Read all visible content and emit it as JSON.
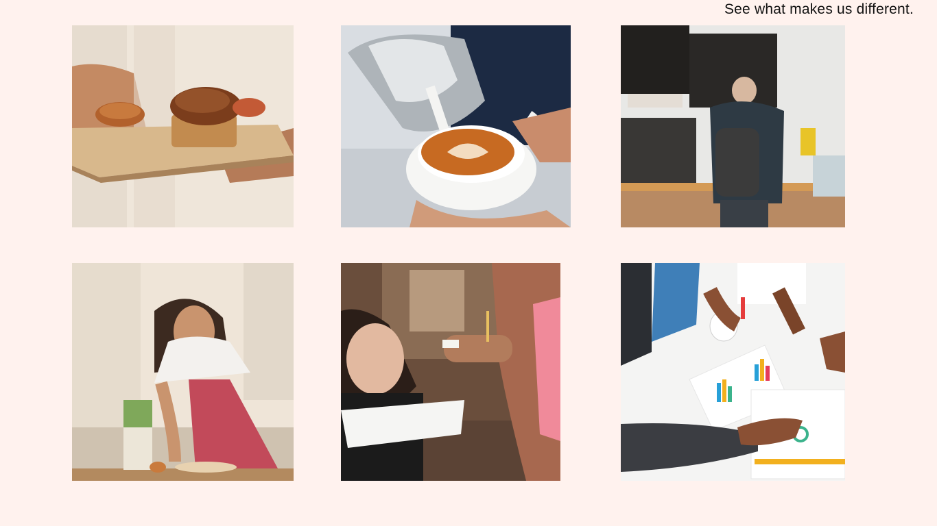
{
  "header": {
    "tagline": "See what makes us different."
  },
  "gallery": {
    "photos": [
      {
        "icon": "pastry-board-photo"
      },
      {
        "icon": "latte-art-photo"
      },
      {
        "icon": "coffee-counter-photo"
      },
      {
        "icon": "baker-kneading-photo"
      },
      {
        "icon": "waitress-order-photo"
      },
      {
        "icon": "team-meeting-photo"
      }
    ]
  },
  "colors": {
    "background": "#fff2ee",
    "text": "#111111"
  }
}
